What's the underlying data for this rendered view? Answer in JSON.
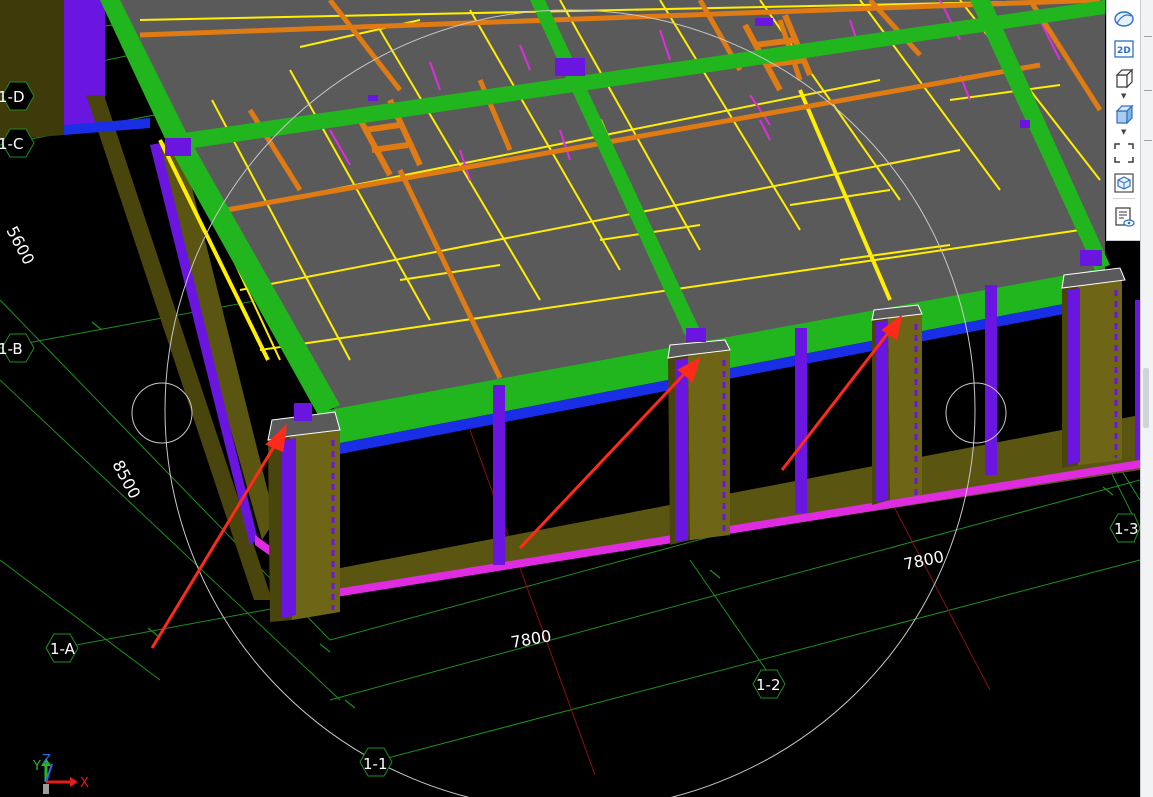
{
  "grid_axes": {
    "rows": [
      "1-D",
      "1-C",
      "1-B",
      "1-A"
    ],
    "cols": [
      "1-1",
      "1-2",
      "1-3"
    ]
  },
  "dimensions": {
    "d_5600": "5600",
    "d_8500": "8500",
    "d_7800_a": "7800",
    "d_7800_b": "7800"
  },
  "toolbar": {
    "tools": [
      "orbit",
      "2d-view",
      "3d-box-view",
      "solid-view",
      "zoom-extents",
      "element-view",
      "properties-view"
    ],
    "button_2d_text": "2D"
  },
  "coordinate_indicator": {
    "x": "X",
    "y": "Y",
    "z": "Z"
  },
  "colors": {
    "background": "#000000",
    "slab": "#5a5a5a",
    "beam_green": "#22b61e",
    "beam_blue": "#1a2ee6",
    "beam_orange": "#e07a12",
    "rebar_yellow": "#ffee00",
    "rebar_magenta": "#e02ce0",
    "column_olive": "#6e6517",
    "column_purple": "#6a16e0",
    "grid_line": "#1f8f1f",
    "annotation_arrow": "#ff2a1a"
  }
}
